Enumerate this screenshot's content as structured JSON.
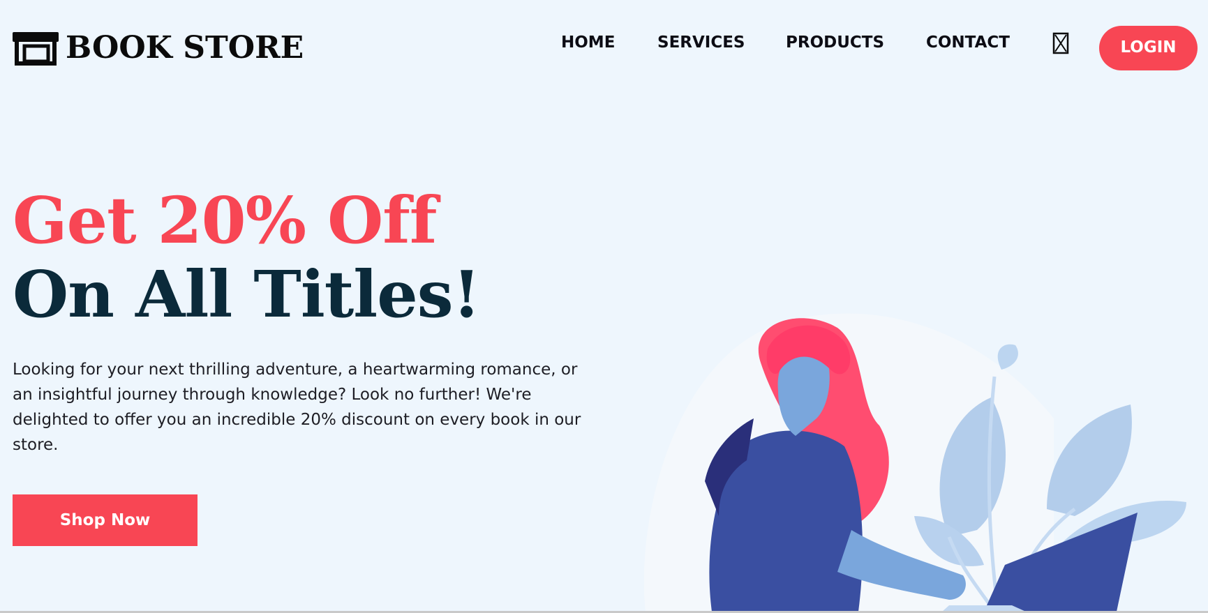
{
  "header": {
    "logo_text": "BOOK STORE",
    "logo_icon": "storefront-icon",
    "nav": {
      "home": "HOME",
      "services": "SERVICES",
      "products": "PRODUCTS",
      "contact": "CONTACT"
    },
    "cart_icon": "cart-icon",
    "login_label": "LOGIN"
  },
  "hero": {
    "headline_line1": "Get 20% Off",
    "headline_line2": "On All Titles!",
    "description": "Looking for your next thrilling adventure, a heartwarming romance, or an insightful journey through knowledge? Look no further! We're delighted to offer you an incredible 20% discount on every book in our store.",
    "cta_label": "Shop Now"
  },
  "colors": {
    "background": "#eef6fd",
    "accent": "#f84654",
    "headline_dark": "#0b2a3a"
  }
}
